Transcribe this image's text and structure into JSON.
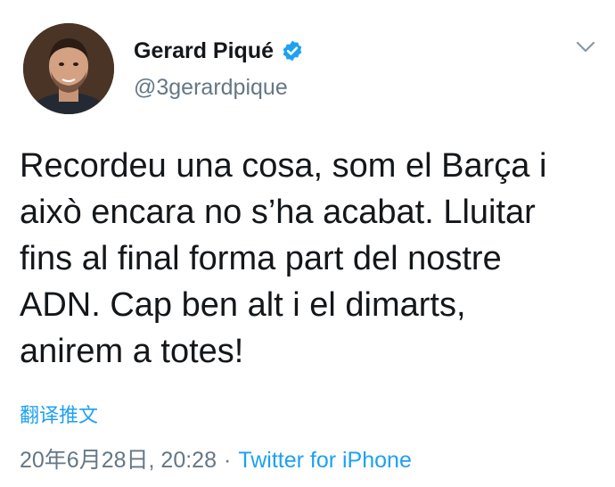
{
  "user": {
    "display_name": "Gerard Piqué",
    "handle": "@3gerardpique"
  },
  "tweet": {
    "text": "Recordeu una cosa, som el Barça i\naixò encara no s’ha acabat. Lluitar\nfins al final forma part del nostre\nADN. Cap ben alt i el dimarts,\nanirem a totes!",
    "translate_label": "翻译推文",
    "timestamp": "20年6月28日, 20:28",
    "separator": "·",
    "source": "Twitter for iPhone"
  },
  "icons": {
    "verified": "verified-badge-icon",
    "menu": "chevron-down-icon"
  },
  "colors": {
    "accent": "#1da1f2",
    "secondary_text": "#657786",
    "primary_text": "#14171a"
  }
}
